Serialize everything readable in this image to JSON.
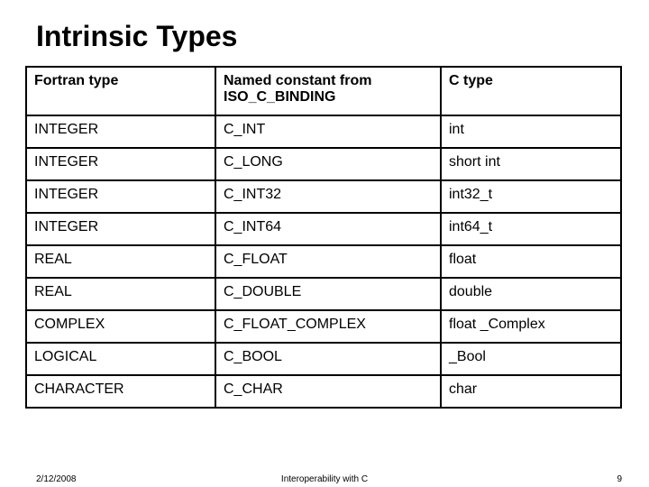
{
  "title": "Intrinsic Types",
  "headers": {
    "col1": "Fortran type",
    "col2": "Named constant from ISO_C_BINDING",
    "col3": "C type"
  },
  "rows": [
    {
      "fortran": "INTEGER",
      "named": "C_INT",
      "ctype": "int"
    },
    {
      "fortran": "INTEGER",
      "named": "C_LONG",
      "ctype": "short int"
    },
    {
      "fortran": "INTEGER",
      "named": "C_INT32",
      "ctype": "int32_t"
    },
    {
      "fortran": "INTEGER",
      "named": "C_INT64",
      "ctype": "int64_t"
    },
    {
      "fortran": "REAL",
      "named": "C_FLOAT",
      "ctype": "float"
    },
    {
      "fortran": "REAL",
      "named": "C_DOUBLE",
      "ctype": "double"
    },
    {
      "fortran": "COMPLEX",
      "named": "C_FLOAT_COMPLEX",
      "ctype": "float _Complex"
    },
    {
      "fortran": "LOGICAL",
      "named": "C_BOOL",
      "ctype": "_Bool"
    },
    {
      "fortran": "CHARACTER",
      "named": "C_CHAR",
      "ctype": "char"
    }
  ],
  "footer": {
    "date": "2/12/2008",
    "center": "Interoperability with C",
    "page": "9"
  }
}
